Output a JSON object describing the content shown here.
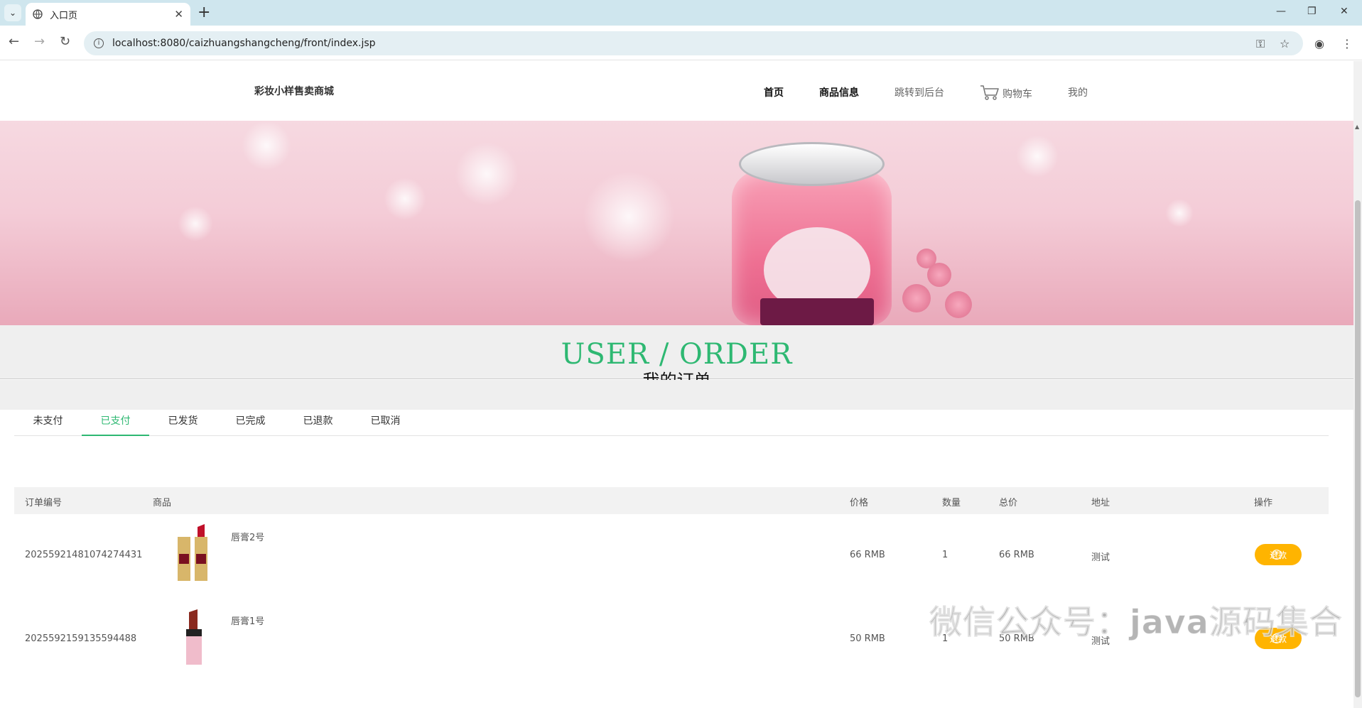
{
  "browser": {
    "tab_title": "入口页",
    "url": "localhost:8080/caizhuangshangcheng/front/index.jsp"
  },
  "site": {
    "brand": "彩妆小样售卖商城",
    "nav": {
      "home": "首页",
      "products": "商品信息",
      "admin": "跳转到后台",
      "cart": "购物车",
      "mine": "我的"
    }
  },
  "section": {
    "title_en": "USER / ORDER",
    "title_zh": "我的订单"
  },
  "order_tabs": [
    "未支付",
    "已支付",
    "已发货",
    "已完成",
    "已退款",
    "已取消"
  ],
  "active_tab": "已支付",
  "table": {
    "headers": {
      "order_no": "订单编号",
      "product": "商品",
      "price": "价格",
      "qty": "数量",
      "total": "总价",
      "address": "地址",
      "action": "操作"
    },
    "rows": [
      {
        "order_no": "20255921481074274431",
        "product_name": "唇膏2号",
        "price": "66 RMB",
        "qty": "1",
        "total": "66 RMB",
        "address": "测试",
        "action": "退款"
      },
      {
        "order_no": "2025592159135594488",
        "product_name": "唇膏1号",
        "price": "50 RMB",
        "qty": "1",
        "total": "50 RMB",
        "address": "测试",
        "action": "退款"
      }
    ]
  },
  "watermark": "微信公众号：java源码集合",
  "colors": {
    "accent_green": "#2eb872",
    "refund_button": "#ffb400"
  }
}
